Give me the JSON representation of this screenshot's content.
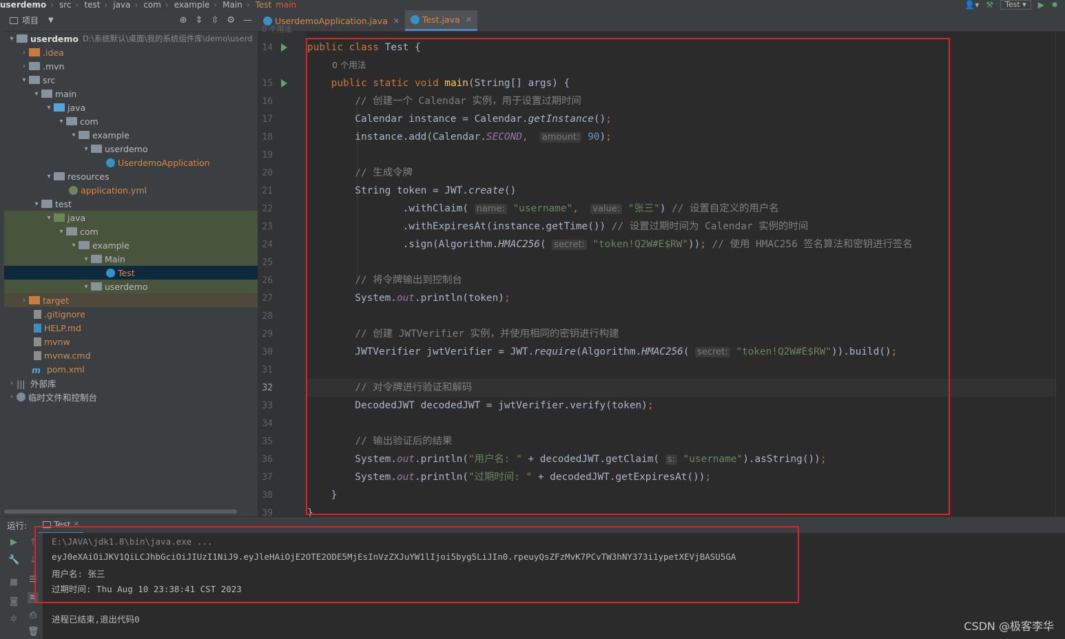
{
  "breadcrumb": {
    "items": [
      "userdemo",
      "src",
      "test",
      "java",
      "com",
      "example",
      "Main",
      "Test",
      "main"
    ],
    "run_config": "Test"
  },
  "project": {
    "title": "项目",
    "root_name": "userdemo",
    "root_path": "D:\\系统默认\\桌面\\我的系统组件库\\demo\\userd",
    "tree": [
      {
        "label": ".idea"
      },
      {
        "label": ".mvn"
      },
      {
        "label": "src"
      },
      {
        "label": "main"
      },
      {
        "label": "java"
      },
      {
        "label": "com"
      },
      {
        "label": "example"
      },
      {
        "label": "userdemo"
      },
      {
        "label": "UserdemoApplication"
      },
      {
        "label": "resources"
      },
      {
        "label": "application.yml"
      },
      {
        "label": "test"
      },
      {
        "label": "java"
      },
      {
        "label": "com"
      },
      {
        "label": "example"
      },
      {
        "label": "Main"
      },
      {
        "label": "Test"
      },
      {
        "label": "userdemo"
      },
      {
        "label": "target"
      },
      {
        "label": ".gitignore"
      },
      {
        "label": "HELP.md"
      },
      {
        "label": "mvnw"
      },
      {
        "label": "mvnw.cmd"
      },
      {
        "label": "pom.xml"
      },
      {
        "label": "外部库"
      },
      {
        "label": "临时文件和控制台"
      }
    ]
  },
  "tabs": [
    {
      "label": "UserdemoApplication.java"
    },
    {
      "label": "Test.java"
    }
  ],
  "editor": {
    "top_partial": "0 个用法",
    "usages": "0 个用法",
    "line_numbers": [
      "14",
      "15",
      "16",
      "17",
      "18",
      "19",
      "20",
      "21",
      "22",
      "23",
      "24",
      "25",
      "26",
      "27",
      "28",
      "29",
      "30",
      "31",
      "32",
      "33",
      "34",
      "35",
      "36",
      "37",
      "38",
      "39"
    ],
    "hints": {
      "amount": "amount:",
      "name": "name:",
      "value": "value:",
      "secret": "secret:",
      "s": "s:"
    },
    "comments": {
      "c16": "// 创建一个 Calendar 实例，用于设置过期时间",
      "c20": "// 生成令牌",
      "c22": "// 设置自定义的用户名",
      "c23": "// 设置过期时间为 Calendar 实例的时间",
      "c24": "// 使用 HMAC256 签名算法和密钥进行签名",
      "c26": "// 将令牌输出到控制台",
      "c29": "// 创建 JWTVerifier 实例，并使用相同的密钥进行构建",
      "c32": "// 对令牌进行验证和解码",
      "c35": "// 输出验证后的结果"
    },
    "strings": {
      "username": "\"username\"",
      "zhangsan": "\"张三\"",
      "token": "\"token!Q2W#E$RW\"",
      "user_label": "\"用户名: \"",
      "expire_label": "\"过期时间: \""
    },
    "number_90": "90"
  },
  "run": {
    "label": "运行:",
    "tab": "Test",
    "lines": [
      "E:\\JAVA\\jdk1.8\\bin\\java.exe ...",
      "eyJ0eXAiOiJKV1QiLCJhbGciOiJIUzI1NiJ9.eyJleHAiOjE2OTE2ODE5MjEsInVzZXJuYW1lIjoi5byg5LiJIn0.rpeuyQsZFzMvK7PCvTW3hNY373i1ypetXEVjBASU5GA",
      "用户名: 张三",
      "过期时间: Thu Aug 10 23:38:41 CST 2023",
      "进程已结束,退出代码0"
    ]
  },
  "watermark": "CSDN @极客李华",
  "colors": {
    "keyword": "#cc7832",
    "string": "#6a8759",
    "comment": "#808080",
    "annotation_box": "#e0232b"
  }
}
